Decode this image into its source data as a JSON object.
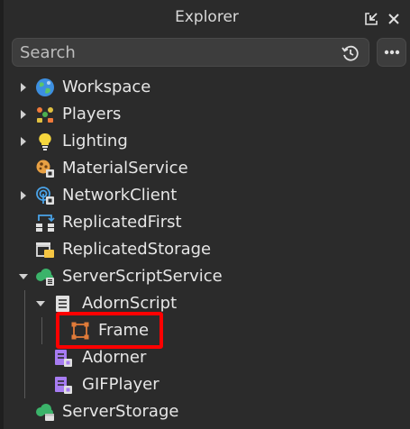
{
  "window": {
    "title": "Explorer"
  },
  "search": {
    "placeholder": "Search",
    "value": ""
  },
  "tree": {
    "items": [
      {
        "label": "Workspace",
        "icon": "workspace-globe-icon",
        "expandable": true,
        "expanded": false
      },
      {
        "label": "Players",
        "icon": "players-icon",
        "expandable": true,
        "expanded": false
      },
      {
        "label": "Lighting",
        "icon": "lightbulb-icon",
        "expandable": true,
        "expanded": false
      },
      {
        "label": "MaterialService",
        "icon": "material-service-icon",
        "expandable": false,
        "expanded": false
      },
      {
        "label": "NetworkClient",
        "icon": "network-client-icon",
        "expandable": true,
        "expanded": false
      },
      {
        "label": "ReplicatedFirst",
        "icon": "replicated-first-icon",
        "expandable": false,
        "expanded": false
      },
      {
        "label": "ReplicatedStorage",
        "icon": "replicated-storage-icon",
        "expandable": false,
        "expanded": false
      },
      {
        "label": "ServerScriptService",
        "icon": "server-script-service-icon",
        "expandable": true,
        "expanded": true
      },
      {
        "label": "AdornScript",
        "icon": "script-icon",
        "expandable": true,
        "expanded": true
      },
      {
        "label": "Frame",
        "icon": "frame-icon",
        "expandable": false,
        "expanded": false,
        "highlighted": true
      },
      {
        "label": "Adorner",
        "icon": "module-script-icon",
        "expandable": false,
        "expanded": false
      },
      {
        "label": "GIFPlayer",
        "icon": "module-script-icon",
        "expandable": false,
        "expanded": false
      },
      {
        "label": "ServerStorage",
        "icon": "server-storage-icon",
        "expandable": false,
        "expanded": false
      }
    ]
  },
  "colors": {
    "background": "#2b2b2b",
    "highlight_border": "#ff0000",
    "frame_icon": "#e07b39",
    "module_icon": "#a77cf2",
    "script_icon": "#e0e0e0"
  }
}
